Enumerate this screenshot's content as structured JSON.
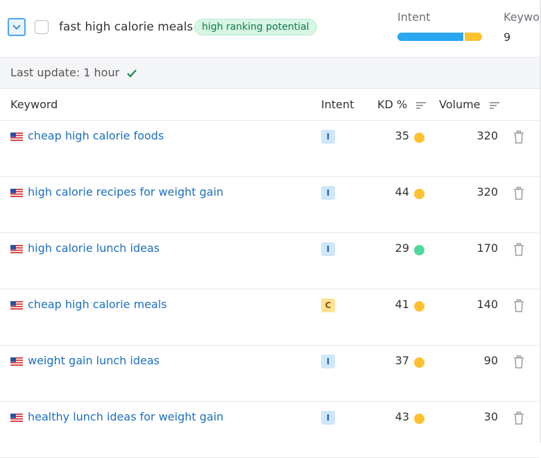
{
  "group": {
    "title": "fast high calorie meals",
    "badge": "high ranking potential",
    "intent_label": "Intent",
    "intent_split": {
      "informational": 0.78,
      "commercial": 0.22
    },
    "keywords_label": "Keywo",
    "keywords_count": "9"
  },
  "update": {
    "text": "Last update: 1 hour",
    "icon": "check-icon"
  },
  "table": {
    "headers": {
      "keyword": "Keyword",
      "intent": "Intent",
      "kd": "KD %",
      "volume": "Volume"
    },
    "rows": [
      {
        "keyword": "cheap high calorie foods",
        "intent": "I",
        "kd": "35",
        "kd_color": "#ffc12f",
        "volume": "320"
      },
      {
        "keyword": "high calorie recipes for weight gain",
        "intent": "I",
        "kd": "44",
        "kd_color": "#ffc12f",
        "volume": "320"
      },
      {
        "keyword": "high calorie lunch ideas",
        "intent": "I",
        "kd": "29",
        "kd_color": "#4ed89c",
        "volume": "170"
      },
      {
        "keyword": "cheap high calorie meals",
        "intent": "C",
        "kd": "41",
        "kd_color": "#ffc12f",
        "volume": "140"
      },
      {
        "keyword": "weight gain lunch ideas",
        "intent": "I",
        "kd": "37",
        "kd_color": "#ffc12f",
        "volume": "90"
      },
      {
        "keyword": "healthy lunch ideas for weight gain",
        "intent": "I",
        "kd": "43",
        "kd_color": "#ffc12f",
        "volume": "30"
      }
    ]
  },
  "colors": {
    "link": "#1b6ec2",
    "accent": "#2ba6f2",
    "commercial": "#ffc12f",
    "easy": "#4ed89c",
    "check": "#0e8a4a"
  }
}
